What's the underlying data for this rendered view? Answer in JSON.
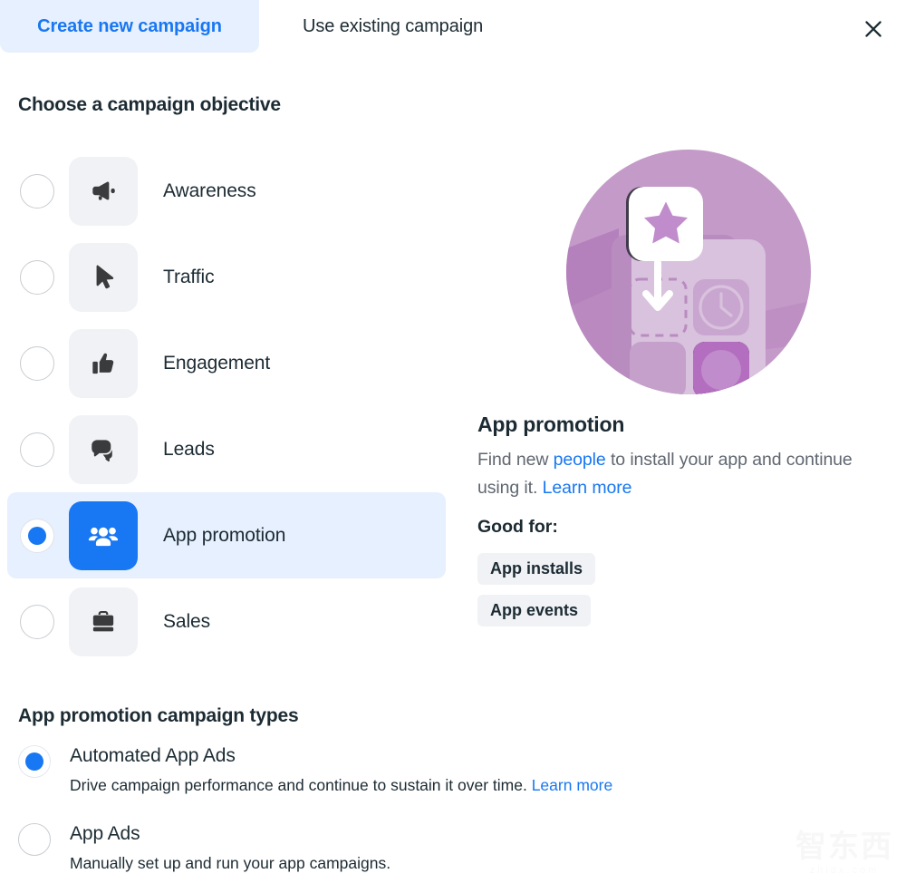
{
  "tabs": [
    {
      "label": "Create new campaign",
      "active": true
    },
    {
      "label": "Use existing campaign",
      "active": false
    }
  ],
  "close_label": "Close",
  "objective_section": {
    "title": "Choose a campaign objective",
    "items": [
      {
        "label": "Awareness",
        "icon": "megaphone-icon",
        "selected": false
      },
      {
        "label": "Traffic",
        "icon": "cursor-icon",
        "selected": false
      },
      {
        "label": "Engagement",
        "icon": "thumbs-up-icon",
        "selected": false
      },
      {
        "label": "Leads",
        "icon": "chat-bubbles-icon",
        "selected": false
      },
      {
        "label": "App promotion",
        "icon": "people-icon",
        "selected": true
      },
      {
        "label": "Sales",
        "icon": "briefcase-icon",
        "selected": false
      }
    ]
  },
  "info_panel": {
    "illustration_name": "app-promotion-illustration",
    "heading": "App promotion",
    "description_part1": "Find new ",
    "description_link1": "people",
    "description_part2": " to install your app and continue using it. ",
    "description_link2": "Learn more",
    "good_for_label": "Good for:",
    "chips": [
      "App installs",
      "App events"
    ]
  },
  "types_section": {
    "title": "App promotion campaign types",
    "items": [
      {
        "name": "Automated App Ads",
        "description": "Drive campaign performance and continue to sustain it over time. ",
        "link": "Learn more",
        "selected": true
      },
      {
        "name": "App Ads",
        "description": "Manually set up and run your app campaigns.",
        "link": "",
        "selected": false
      }
    ]
  },
  "watermark": {
    "mark": "智东西",
    "sub": "zhidx.com"
  },
  "colors": {
    "accent": "#1877f2",
    "accent_bg": "#e7f0fe",
    "tile_bg": "#f0f2f5",
    "text": "#1c2b33",
    "muted": "#606770",
    "illustration_circle": "#c49ac8"
  }
}
